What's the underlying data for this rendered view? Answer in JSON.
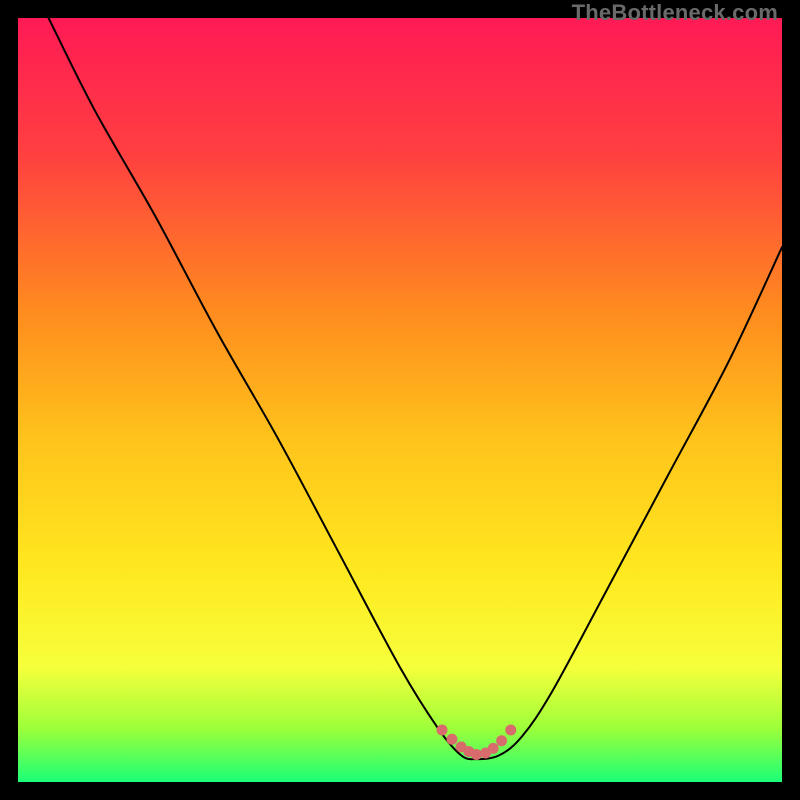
{
  "watermark": "TheBottleneck.com",
  "background_color": "#000000",
  "gradient_stops": [
    {
      "offset": 0.0,
      "color": "#ff1a55"
    },
    {
      "offset": 0.18,
      "color": "#ff4040"
    },
    {
      "offset": 0.38,
      "color": "#ff8a1f"
    },
    {
      "offset": 0.55,
      "color": "#ffc31b"
    },
    {
      "offset": 0.72,
      "color": "#ffe81f"
    },
    {
      "offset": 0.85,
      "color": "#f6ff3b"
    },
    {
      "offset": 0.93,
      "color": "#9cff3a"
    },
    {
      "offset": 1.0,
      "color": "#1bff77"
    }
  ],
  "chart_data": {
    "type": "line",
    "title": "",
    "xlabel": "",
    "ylabel": "",
    "xlim": [
      0,
      100
    ],
    "ylim": [
      0,
      100
    ],
    "series": [
      {
        "name": "bottleneck-curve",
        "stroke": "#000000",
        "stroke_width": 2,
        "x": [
          4,
          10,
          18,
          26,
          34,
          42,
          50,
          55,
          58,
          60,
          63,
          66,
          70,
          77,
          85,
          93,
          100
        ],
        "y": [
          100,
          88,
          74,
          59,
          45,
          30,
          15,
          7,
          3.5,
          3,
          3.5,
          6,
          12,
          25,
          40,
          55,
          70
        ]
      }
    ],
    "markers": [
      {
        "name": "highlight-dots",
        "color": "#d86b6b",
        "radius_px": 5.5,
        "x": [
          55.5,
          56.8,
          58.0,
          59.0,
          60.0,
          61.2,
          62.2,
          63.3,
          64.5
        ],
        "y": [
          6.8,
          5.6,
          4.6,
          4.0,
          3.6,
          3.8,
          4.4,
          5.4,
          6.8
        ]
      }
    ]
  }
}
